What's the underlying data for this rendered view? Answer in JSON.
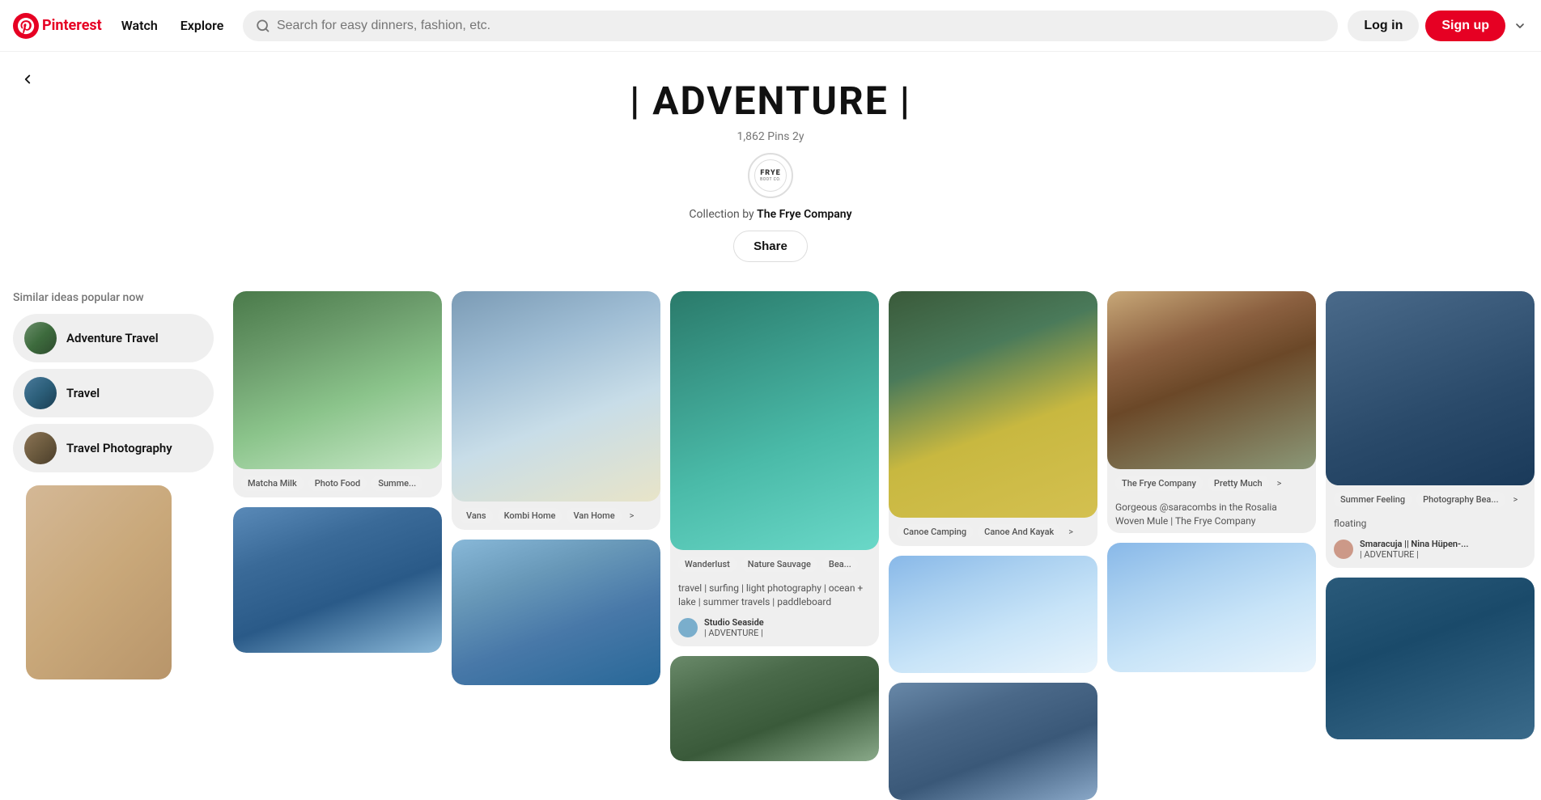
{
  "header": {
    "logo_text": "Pinterest",
    "nav": [
      {
        "label": "Watch",
        "id": "watch"
      },
      {
        "label": "Explore",
        "id": "explore"
      }
    ],
    "search_placeholder": "Search for easy dinners, fashion, etc.",
    "login_label": "Log in",
    "signup_label": "Sign up"
  },
  "board": {
    "title": "| ADVENTURE |",
    "pins_count": "1,862",
    "pins_label": "Pins",
    "age": "2y",
    "frye_label": "FRYE",
    "frye_sub": "BOOT CO.",
    "collection_prefix": "Collection by",
    "collection_author": "The Frye Company",
    "share_label": "Share"
  },
  "sidebar": {
    "similar_label": "Similar ideas popular now",
    "items": [
      {
        "label": "Adventure Travel",
        "id": "adventure-travel"
      },
      {
        "label": "Travel",
        "id": "travel"
      },
      {
        "label": "Travel Photography",
        "id": "travel-photography"
      }
    ]
  },
  "pins": {
    "col1": [
      {
        "id": "picnic",
        "tags": []
      }
    ],
    "col2": [
      {
        "id": "matcha",
        "tags": [
          "Matcha Milk",
          "Photo Food",
          "Summe..."
        ],
        "more": false
      },
      {
        "id": "rock",
        "tags": []
      }
    ],
    "col3": [
      {
        "id": "van",
        "tags": [
          "Vans",
          "Kombi Home",
          "Van Home"
        ],
        "more": true
      },
      {
        "id": "iceberg",
        "tags": []
      }
    ],
    "col4": [
      {
        "id": "water",
        "tags": [
          "Wanderlust",
          "Nature Sauvage",
          "Bea..."
        ],
        "description": "travel | surfing | light photography | ocean + lake | summer travels | paddleboard",
        "user_name": "Studio Seaside",
        "user_board": "| ADVENTURE |"
      },
      {
        "id": "tent",
        "tags": []
      }
    ],
    "col5": [
      {
        "id": "canoe",
        "tags": [
          "Canoe Camping",
          "Canoe And Kayak"
        ],
        "more": true
      },
      {
        "id": "cloud",
        "tags": []
      },
      {
        "id": "mountain",
        "tags": []
      }
    ],
    "col6": [
      {
        "id": "cactus",
        "tags": [
          "The Frye Company",
          "Pretty Much"
        ],
        "more": true,
        "description": "Gorgeous @saracombs in the Rosalia Woven Mule | The Frye Company"
      },
      {
        "id": "cloud2",
        "tags": []
      }
    ],
    "col7": [
      {
        "id": "boat",
        "tags": [
          "Summer Feeling",
          "Photography Bea..."
        ],
        "more": true,
        "pin_label": "floating",
        "user_name": "Smaracuja || Nina Hüpen-...",
        "user_board": "| ADVENTURE |"
      },
      {
        "id": "swim",
        "tags": []
      }
    ]
  }
}
